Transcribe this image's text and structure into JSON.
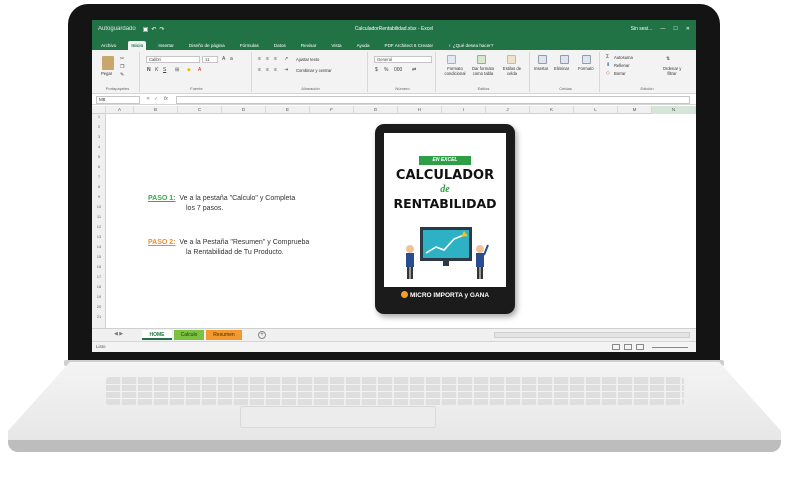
{
  "window": {
    "autosave": "Autoguardado",
    "title": "CalculadorRentabilidad.xlsx - Excel",
    "user": "Sin sesi...",
    "controls": [
      "—",
      "☐",
      "✕"
    ]
  },
  "ribbon_tabs": [
    "Archivo",
    "Inicio",
    "Insertar",
    "Diseño de página",
    "Fórmulas",
    "Datos",
    "Revisar",
    "Vista",
    "Ayuda",
    "PDF Architect 6 Creator"
  ],
  "active_tab": "Inicio",
  "tell_me": "¿Qué desea hacer?",
  "ribbon": {
    "paste_label": "Pegar",
    "font_name": "Calibri",
    "font_size": "11",
    "wrap_text": "Ajustar texto",
    "merge_center": "Combinar y centrar",
    "number_format": "General",
    "cond_format": "Formato condicional",
    "format_table": "Dar formato como tabla",
    "cell_styles": "Estilos de celda",
    "insert": "Insertar",
    "delete": "Eliminar",
    "format": "Formato",
    "autosum": "Autosuma",
    "fill": "Rellenar",
    "clear": "Borrar",
    "sort_filter": "Ordenar y filtrar",
    "groups": {
      "clipboard": "Portapapeles",
      "font": "Fuente",
      "alignment": "Alineación",
      "number": "Número",
      "styles": "Estilos",
      "cells": "Celdas",
      "editing": "Edición"
    }
  },
  "formula_bar": {
    "name_box": "M8",
    "fx": "fx",
    "value": ""
  },
  "columns": [
    "A",
    "B",
    "C",
    "D",
    "E",
    "F",
    "G",
    "H",
    "I",
    "J",
    "K",
    "L",
    "M",
    "N"
  ],
  "rows": [
    "1",
    "2",
    "3",
    "4",
    "5",
    "6",
    "7",
    "8",
    "9",
    "10",
    "11",
    "12",
    "13",
    "14",
    "15",
    "16",
    "17",
    "18",
    "19",
    "20",
    "21"
  ],
  "instructions": [
    {
      "label": "PASO 1:",
      "line1": "Ve a la pestaña \"Calculo\" y Completa",
      "line2": "los 7 pasos.",
      "color": "#3aaa4c"
    },
    {
      "label": "PASO 2:",
      "line1": "Ve a la Pestaña \"Resumen\" y Comprueba",
      "line2": "la Rentabilidad de Tu Producto.",
      "color": "#ef8c2b"
    }
  ],
  "cover": {
    "badge": "EN EXCEL",
    "title1": "CALCULADOR",
    "title2": "de",
    "title3": "RENTABILIDAD",
    "footer": "MICRO IMPORTA y GANA"
  },
  "sheets": [
    {
      "name": "HOME",
      "active": true
    },
    {
      "name": "Calculo",
      "color": "#7bc242"
    },
    {
      "name": "Resumen",
      "color": "#f29a2e"
    }
  ],
  "status": {
    "text": "Listo"
  },
  "colors": {
    "excel_green": "#217346"
  }
}
